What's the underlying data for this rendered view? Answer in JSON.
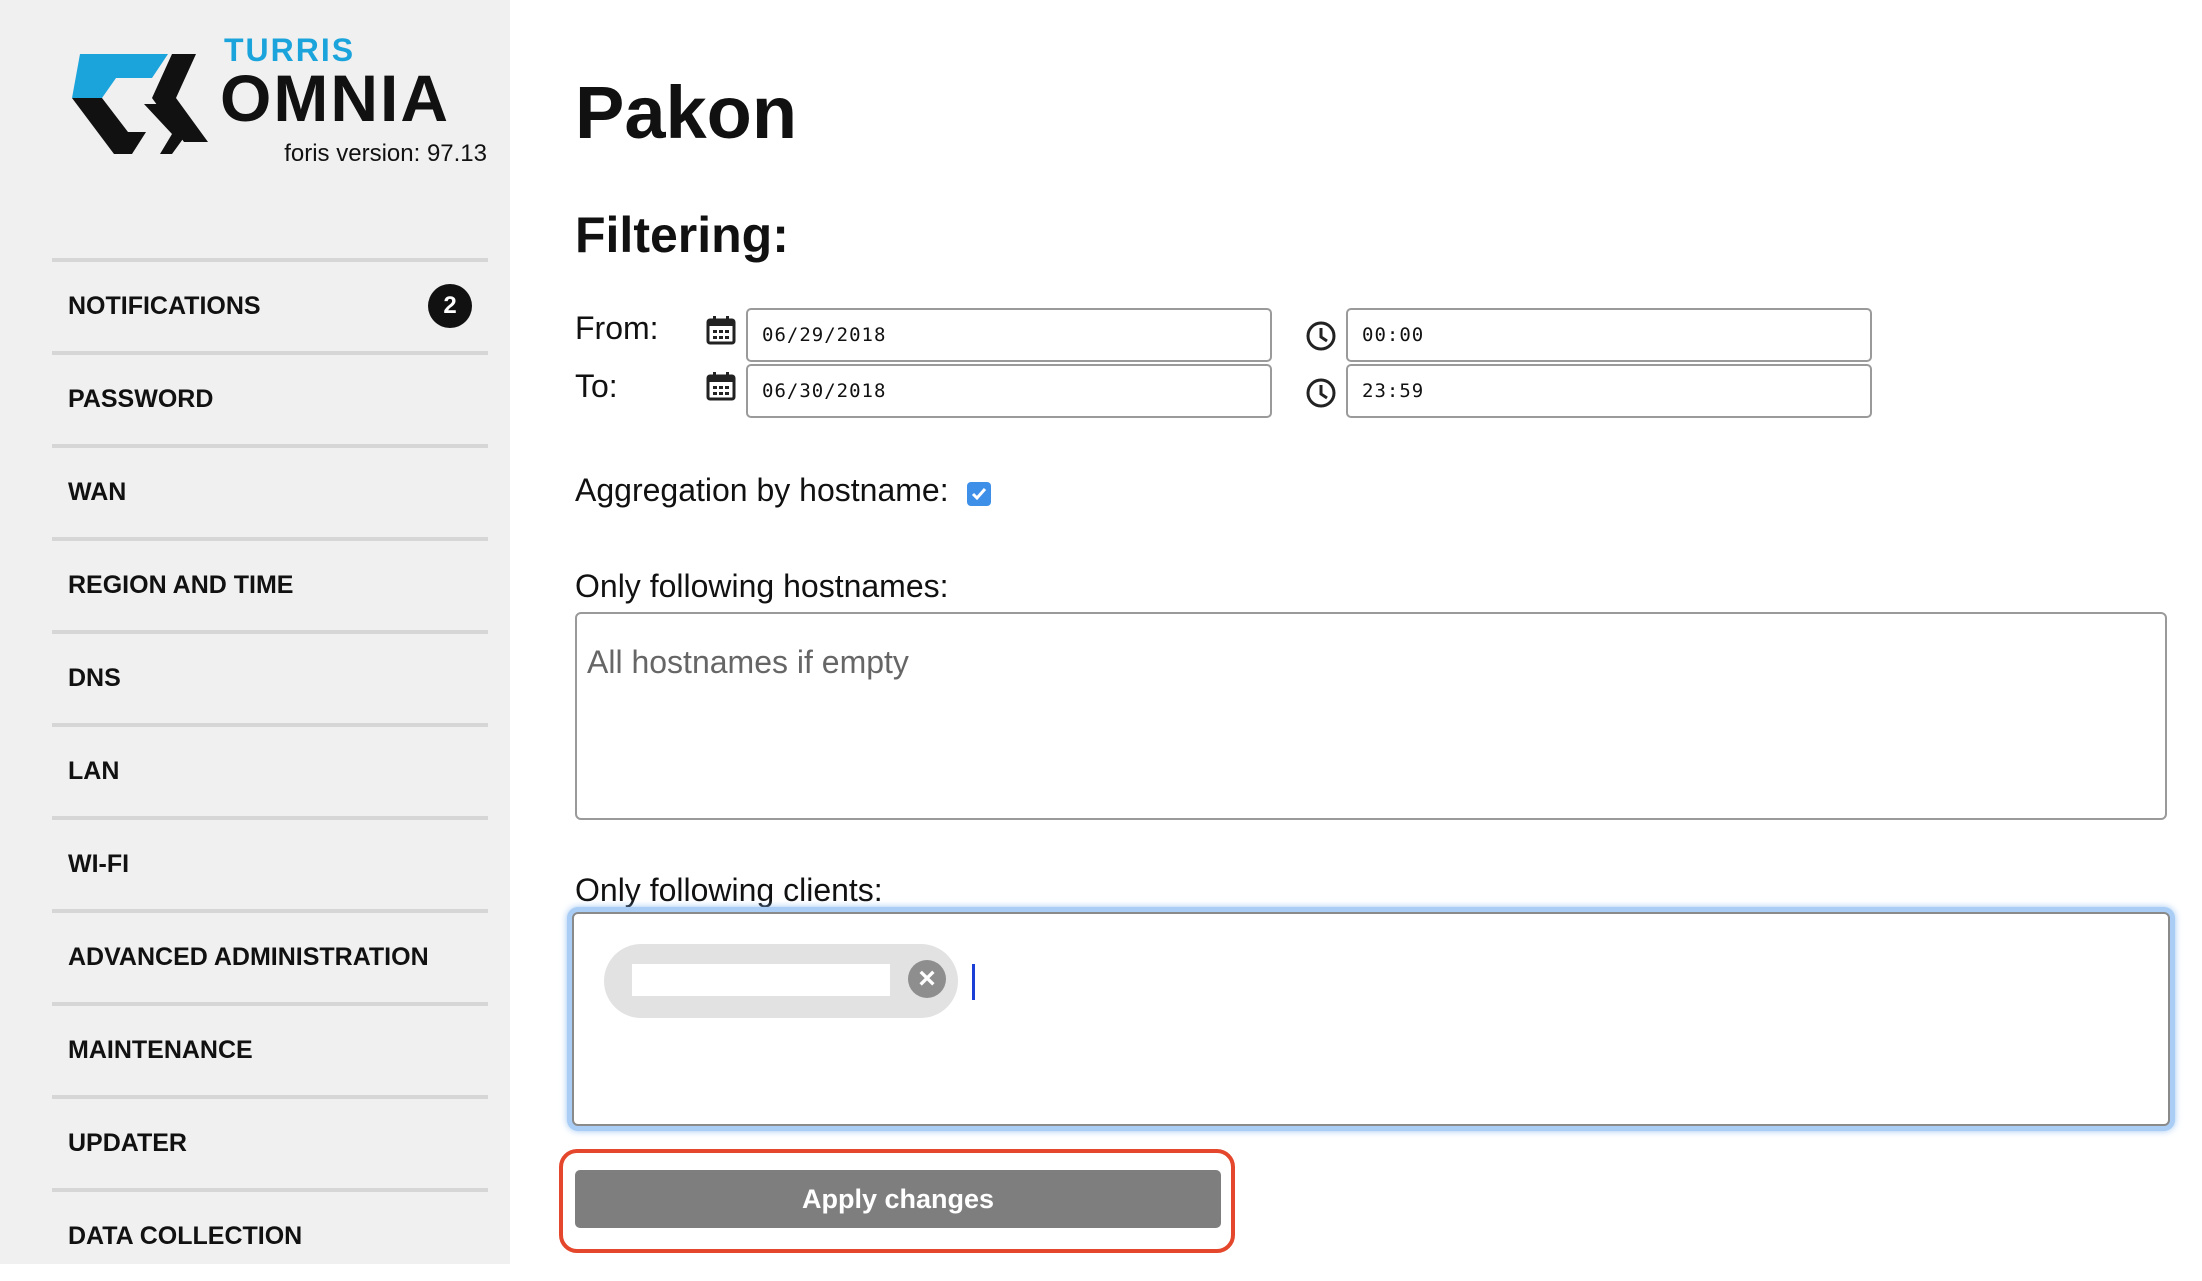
{
  "brand": {
    "turris": "TURRIS",
    "omnia": "OMNIA",
    "version_label": "foris version:",
    "version": "97.13",
    "colors": {
      "accent": "#1ba4dc",
      "dark": "#111111"
    }
  },
  "sidebar": {
    "items": [
      {
        "label": "NOTIFICATIONS",
        "badge": "2"
      },
      {
        "label": "PASSWORD"
      },
      {
        "label": "WAN"
      },
      {
        "label": "REGION AND TIME"
      },
      {
        "label": "DNS"
      },
      {
        "label": "LAN"
      },
      {
        "label": "WI-FI"
      },
      {
        "label": "ADVANCED ADMINISTRATION"
      },
      {
        "label": "MAINTENANCE"
      },
      {
        "label": "UPDATER"
      },
      {
        "label": "DATA COLLECTION"
      }
    ]
  },
  "main": {
    "title": "Pakon",
    "filtering_title": "Filtering:",
    "from": {
      "label": "From:",
      "date": "06/29/2018",
      "time": "00:00",
      "icons": [
        "calendar-icon",
        "clock-icon"
      ]
    },
    "to": {
      "label": "To:",
      "date": "06/30/2018",
      "time": "23:59",
      "icons": [
        "calendar-icon",
        "clock-icon"
      ]
    },
    "aggregation": {
      "label": "Aggregation by hostname:",
      "checked": true
    },
    "hostnames": {
      "label": "Only following hostnames:",
      "placeholder": "All hostnames if empty",
      "value": ""
    },
    "clients": {
      "label": "Only following clients:",
      "tags": 1
    },
    "apply_button": "Apply changes",
    "highlight_color": "#e4472b",
    "focus_color": "#7fb3ee"
  }
}
